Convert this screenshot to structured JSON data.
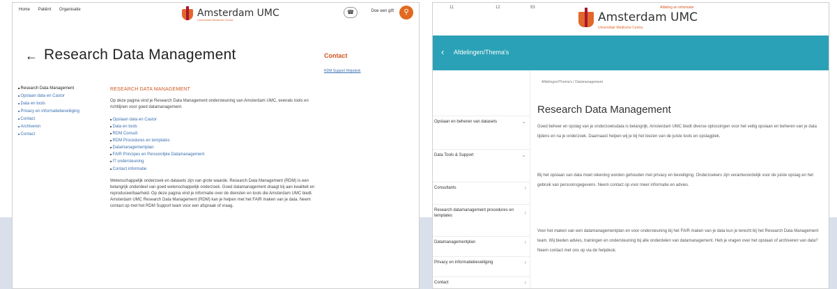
{
  "left": {
    "topnav": [
      "Home",
      "Patiënt",
      "Organisatie"
    ],
    "lang": "Doe een gift",
    "logo": {
      "name": "Amsterdam UMC",
      "tag": "Universitair Medische Centra"
    },
    "title": "Research Data Management",
    "contact": {
      "title": "Contact",
      "link": "RDM Support Helpdesk"
    },
    "nav": [
      "Research Data Management",
      "Opslaan data en Castor",
      "Data en tools",
      "Privacy en informatiebeveiliging",
      "Contact",
      "Archiveren",
      "Contact"
    ],
    "content": {
      "heading": "RESEARCH DATA MANAGEMENT",
      "intro": "Op deze pagina vind je Research Data Management ondersteuning van Amsterdam UMC, evenals tools en richtlijnen voor goed datamanagement.",
      "list": [
        "Opslaan data en Castor",
        "Data en tools",
        "RDM Consult",
        "RDM Procedures en templates",
        "Datamanagementplan",
        "FAIR Principes en Persoonlijke Datamanagement",
        "IT ondersteuning",
        "Contact informatie"
      ],
      "body": "Wetenschappelijk onderzoek en datasets zijn van grote waarde. Research Data Management (RDM) is een belangrijk onderdeel van goed wetenschappelijk onderzoek. Goed datamanagement draagt bij aan kwaliteit en reproduceerbaarheid. Op deze pagina vind je informatie over de diensten en tools die Amsterdam UMC biedt. Amsterdam UMC Research Data Management (RDM) kan je helpen met het FAIR maken van je data. Neem contact op met het RDM Support team voor een afspraak of vraag."
    }
  },
  "right": {
    "status_left": [
      "11",
      "12",
      "93"
    ],
    "top_link": "Afdeling en informatie",
    "logo": {
      "name": "Amsterdam UMC",
      "tag": "Universitair Medische Centra"
    },
    "teal_title": "Afdelingen/Thema's",
    "breadcrumb": "Afdelingen/Thema's / Datamanagement",
    "title": "Research Data Management",
    "nav": [
      "Opslaan en beheren van datasets",
      "Data Tools & Support",
      "Consultants",
      "Research datamanagement procedures en templates",
      "Datamanagementplan",
      "Privacy en informatiebeveiliging",
      "Contact"
    ],
    "paras": [
      "Goed beheer en opslag van je onderzoeksdata is belangrijk. Amsterdam UMC biedt diverse oplossingen voor het veilig opslaan en beheren van je data tijdens en na je onderzoek. Daarnaast helpen wij je bij het kiezen van de juiste tools en opslagplek.",
      "Bij het opslaan van data moet rekening worden gehouden met privacy en beveiliging. Onderzoekers zijn verantwoordelijk voor de juiste opslag en het gebruik van persoonsgegevens. Neem contact op voor meer informatie en advies.",
      "Voor het maken van een datamanagementplan en voor ondersteuning bij het FAIR maken van je data kun je terecht bij het Research Data Management team. Wij bieden advies, trainingen en ondersteuning bij alle onderdelen van datamanagement. Heb je vragen over het opslaan of archiveren van data? Neem contact met ons op via de helpdesk."
    ]
  }
}
